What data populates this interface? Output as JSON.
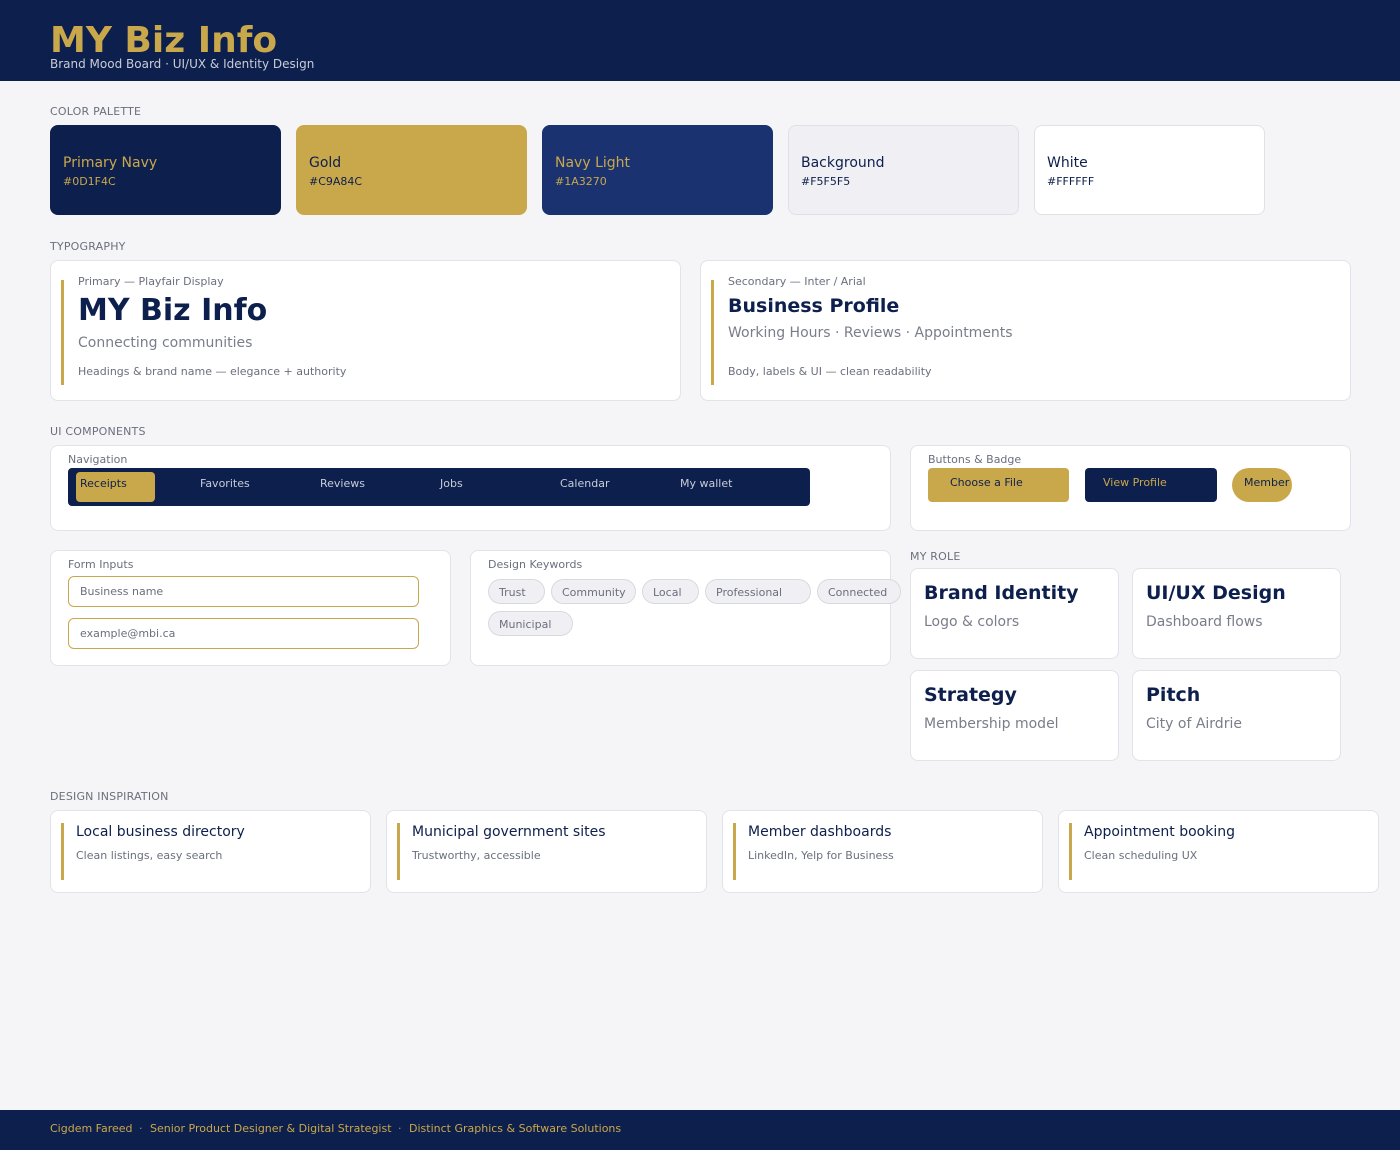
{
  "header": {
    "title": "MY Biz Info",
    "subtitle": "Brand Mood Board  ·  UI/UX & Identity Design"
  },
  "sections": {
    "color_palette": "COLOR PALETTE",
    "typography": "TYPOGRAPHY",
    "ui_components": "UI COMPONENTS",
    "my_role": "MY ROLE",
    "design_inspiration": "DESIGN INSPIRATION"
  },
  "palette": [
    {
      "name": "Primary Navy",
      "hex": "#0D1F4C",
      "bg": "#0D1F4C",
      "text": "#C9A84C"
    },
    {
      "name": "Gold",
      "hex": "#C9A84C",
      "bg": "#C9A84C",
      "text": "#0D1F4C"
    },
    {
      "name": "Navy Light",
      "hex": "#1A3270",
      "bg": "#1A3270",
      "text": "#C9A84C"
    },
    {
      "name": "Background",
      "hex": "#F5F5F5",
      "bg": "#F0F0F4",
      "text": "#0D1F4C"
    },
    {
      "name": "White",
      "hex": "#FFFFFF",
      "bg": "#FFFFFF",
      "text": "#0D1F4C"
    }
  ],
  "typography": {
    "primary": {
      "label": "Primary — Playfair Display",
      "sample": "MY Biz Info",
      "tagline": "Connecting communities",
      "note": "Headings & brand name — elegance + authority"
    },
    "secondary": {
      "label": "Secondary — Inter / Arial",
      "sample": "Business Profile",
      "tagline": "Working Hours · Reviews · Appointments",
      "note": "Body, labels & UI — clean readability"
    }
  },
  "components": {
    "navigation": {
      "label": "Navigation",
      "items": [
        "Receipts",
        "Favorites",
        "Reviews",
        "Jobs",
        "Calendar",
        "My wallet"
      ],
      "active": "Receipts"
    },
    "buttons": {
      "label": "Buttons & Badge",
      "choose_file": "Choose a File",
      "view_profile": "View Profile",
      "badge": "Member"
    },
    "form": {
      "label": "Form Inputs",
      "business_placeholder": "Business name",
      "email_placeholder": "example@mbi.ca"
    },
    "keywords": {
      "label": "Design Keywords",
      "items": [
        "Trust",
        "Community",
        "Local",
        "Professional",
        "Connected",
        "Municipal"
      ]
    }
  },
  "roles": [
    {
      "title": "Brand Identity",
      "subtitle": "Logo & colors"
    },
    {
      "title": "UI/UX Design",
      "subtitle": "Dashboard flows"
    },
    {
      "title": "Strategy",
      "subtitle": "Membership model"
    },
    {
      "title": "Pitch",
      "subtitle": "City of Airdrie"
    }
  ],
  "inspiration": [
    {
      "title": "Local business directory",
      "subtitle": "Clean listings, easy search"
    },
    {
      "title": "Municipal government sites",
      "subtitle": "Trustworthy, accessible"
    },
    {
      "title": "Member dashboards",
      "subtitle": "LinkedIn, Yelp for Business"
    },
    {
      "title": "Appointment booking",
      "subtitle": "Clean scheduling UX"
    }
  ],
  "footer": {
    "name": "Cigdem Fareed",
    "role": "Senior Product Designer & Digital Strategist",
    "company": "Distinct Graphics & Software Solutions",
    "separator": "·"
  },
  "colors": {
    "navy": "#0D1F4C",
    "gold": "#C9A84C",
    "navy_light": "#1A3270",
    "background": "#F5F5F7"
  }
}
